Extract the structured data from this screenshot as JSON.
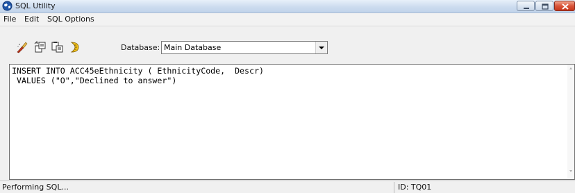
{
  "window": {
    "title": "SQL Utility",
    "icon": "globe-app-icon",
    "controls": {
      "minimize": "minimize-icon",
      "maximize": "maximize-icon",
      "close": "close-icon"
    }
  },
  "menu": {
    "items": [
      "File",
      "Edit",
      "SQL Options"
    ]
  },
  "toolbar": {
    "icons": [
      "clear-icon",
      "copy-icon",
      "paste-icon",
      "run-icon"
    ],
    "database_label": "Database:",
    "database_value": "Main Database"
  },
  "editor": {
    "lines": [
      "INSERT INTO ACC45eEthnicity ( EthnicityCode,  Descr)",
      " VALUES (\"O\",\"Declined to answer\")"
    ]
  },
  "status": {
    "message": "Performing SQL...",
    "id": "ID: TQ01"
  },
  "colors": {
    "title_bar": "#cddcef",
    "close_button": "#d9553a",
    "editor_bg": "#ffffff"
  }
}
